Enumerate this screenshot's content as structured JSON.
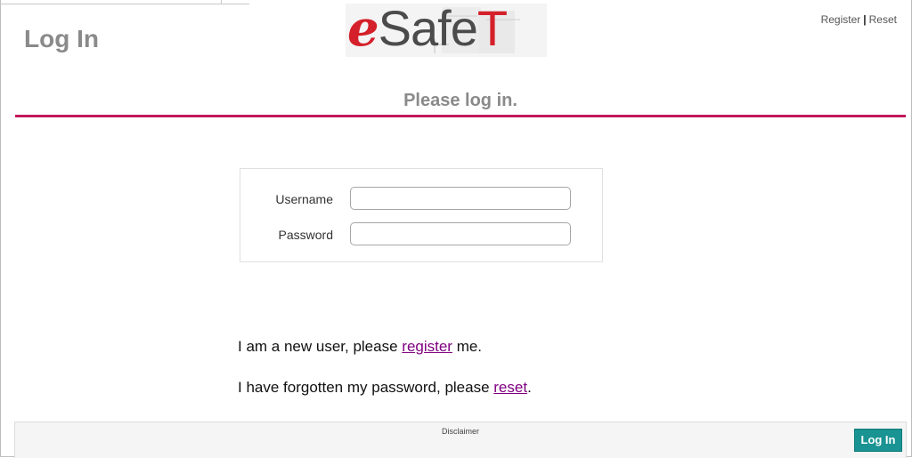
{
  "header": {
    "title": "Log In",
    "logo": {
      "text_e": "e",
      "text_middle": "Safe",
      "text_t": "T",
      "color_e": "#d4202a",
      "color_middle": "#4b4b4b",
      "color_t": "#d4202a"
    },
    "links": {
      "register": "Register",
      "separator": "|",
      "reset": "Reset"
    }
  },
  "subtitle": "Please log in.",
  "accent_color": "#c2185b",
  "form": {
    "username_label": "Username",
    "username_value": "",
    "password_label": "Password",
    "password_value": ""
  },
  "help": {
    "new_user_prefix": "I am a new user, please ",
    "new_user_link": "register",
    "new_user_suffix": " me.",
    "forgot_prefix": "I have forgotten my password, please ",
    "forgot_link": "reset",
    "forgot_suffix": "."
  },
  "link_color": "#800080",
  "footer": {
    "disclaimer": "Disclaimer",
    "login_button": "Log In",
    "button_color": "#1a9393"
  }
}
